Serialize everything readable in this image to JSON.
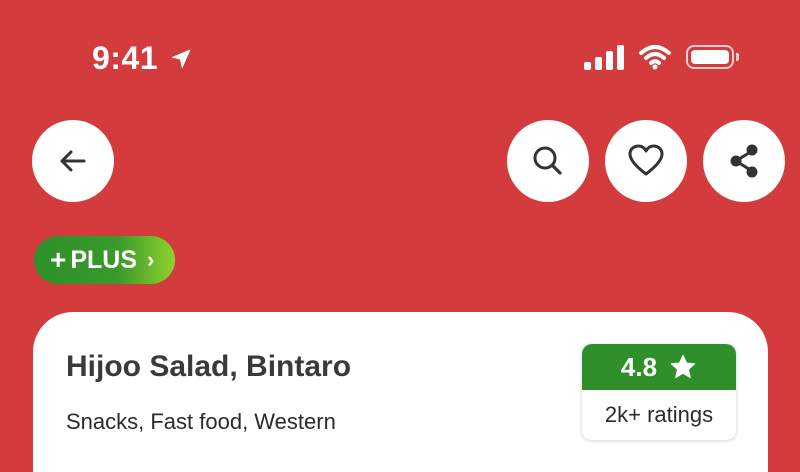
{
  "status_bar": {
    "time": "9:41",
    "icons": [
      "location-arrow-icon",
      "signal-icon",
      "wifi-icon",
      "battery-icon"
    ]
  },
  "header": {
    "buttons": [
      "back-icon",
      "search-icon",
      "heart-icon",
      "share-icon"
    ]
  },
  "badge": {
    "label": "PLUS",
    "prefix_icon": "plus-sign-icon",
    "chevron": "›"
  },
  "restaurant": {
    "name": "Hijoo Salad, Bintaro",
    "categories": "Snacks, Fast food, Western",
    "rating": "4.8",
    "rating_count": "2k+ ratings"
  },
  "colors": {
    "header_bg": "#d33b3c",
    "accent_green": "#2f8f2a",
    "card_bg": "#ffffff"
  }
}
